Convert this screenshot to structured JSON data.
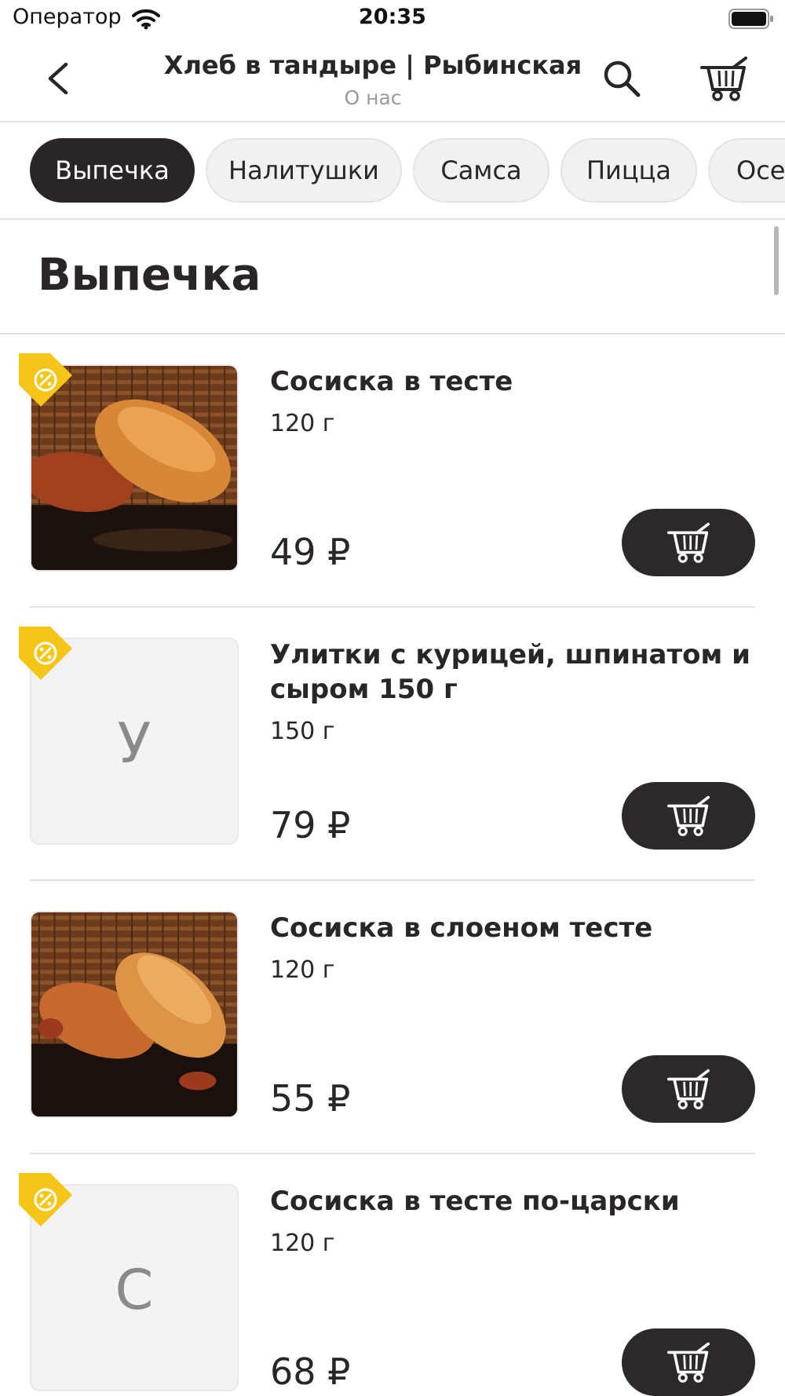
{
  "status": {
    "carrier": "Оператор",
    "time": "20:35"
  },
  "header": {
    "title": "Хлеб в тандыре | Рыбинская",
    "subtitle": "О нас",
    "icons": {
      "back": "chevron-left-icon",
      "search": "search-icon",
      "cart": "cart-icon"
    }
  },
  "tabs": [
    {
      "label": "Выпечка",
      "active": true
    },
    {
      "label": "Налитушки",
      "active": false
    },
    {
      "label": "Самса",
      "active": false
    },
    {
      "label": "Пицца",
      "active": false
    },
    {
      "label": "Осе",
      "active": false
    }
  ],
  "section": {
    "title": "Выпечка"
  },
  "products": [
    {
      "name": "Сосиска в тесте",
      "weight": "120 г",
      "price": "49 ₽",
      "discount": true,
      "image": "photo"
    },
    {
      "name": "Улитки с курицей, шпинатом и сыром 150 г",
      "weight": "150 г",
      "price": "79 ₽",
      "discount": true,
      "placeholder_letter": "У"
    },
    {
      "name": "Сосиска в слоеном тесте",
      "weight": "120 г",
      "price": "55 ₽",
      "discount": false,
      "image": "photo"
    },
    {
      "name": "Сосиска в тесте по-царски",
      "weight": "120 г",
      "price": "68 ₽",
      "discount": true,
      "placeholder_letter": "С"
    }
  ],
  "colors": {
    "accent": "#2a2625",
    "tag": "#f5c518",
    "muted": "#9a9a9a"
  }
}
